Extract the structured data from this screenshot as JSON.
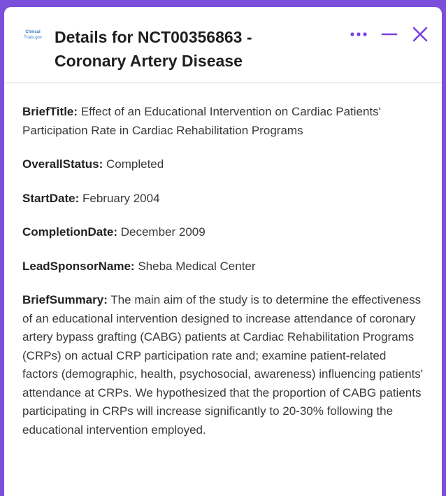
{
  "header": {
    "logo_line1": "Clinical",
    "logo_line2": "Trials.gov",
    "title": "Details for NCT00356863 - Coronary Artery Disease"
  },
  "details": [
    {
      "key": "BriefTitle:",
      "value": "Effect of an Educational Intervention on Cardiac Patients' Participation Rate in Cardiac Rehabilitation Programs"
    },
    {
      "key": "OverallStatus:",
      "value": "Completed"
    },
    {
      "key": "StartDate:",
      "value": "February 2004"
    },
    {
      "key": "CompletionDate:",
      "value": "December 2009"
    },
    {
      "key": "LeadSponsorName:",
      "value": "Sheba Medical Center"
    },
    {
      "key": "BriefSummary:",
      "value": "The main aim of the study is to determine the effectiveness of an educational intervention designed to increase attendance of coronary artery bypass grafting (CABG) patients at Cardiac Rehabilitation Programs (CRPs) on actual CRP participation rate and; examine patient-related factors (demographic, health, psychosocial, awareness) influencing patients' attendance at CRPs. We hypothesized that the proportion of CABG patients participating in CRPs will increase significantly to 20-30% following the educational intervention employed."
    }
  ],
  "icons": {
    "more": "more-horizontal-icon",
    "minimize": "minimize-icon",
    "close": "close-icon"
  },
  "colors": {
    "accent": "#7b3fe4",
    "frame": "#7b4fd9"
  }
}
